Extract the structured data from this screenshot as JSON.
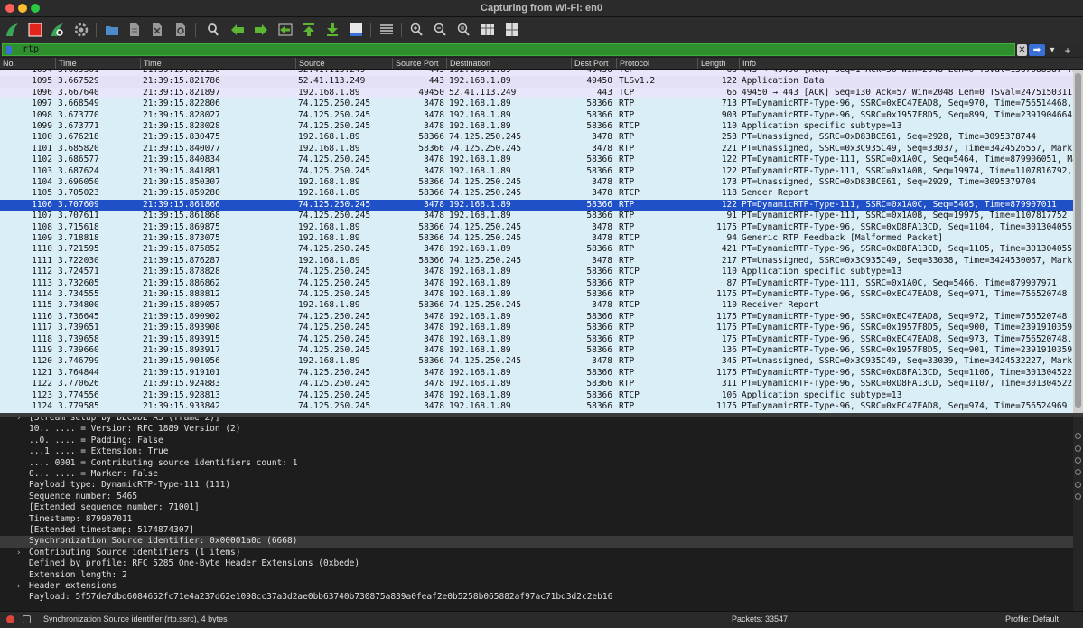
{
  "window": {
    "title": "Capturing from Wi-Fi: en0"
  },
  "colors": {
    "filter_bg": "#2f8f2f",
    "selected_row": "#1f50c8",
    "rtp_row": "#daeef8",
    "tls_row": "#e4e0f6",
    "tcp_row": "#e7e6fa"
  },
  "toolbar": {
    "buttons": [
      {
        "name": "start-capture-icon",
        "symbol": "shark-fin"
      },
      {
        "name": "stop-capture-icon",
        "symbol": "stop-square"
      },
      {
        "name": "restart-capture-icon",
        "symbol": "shark-fin-restart"
      },
      {
        "name": "capture-options-icon",
        "symbol": "gear"
      },
      {
        "name": "open-file-icon",
        "symbol": "folder"
      },
      {
        "name": "save-file-icon",
        "symbol": "file"
      },
      {
        "name": "close-file-icon",
        "symbol": "file-x"
      },
      {
        "name": "reload-file-icon",
        "symbol": "file-reload"
      },
      {
        "name": "find-packet-icon",
        "symbol": "magnifier"
      },
      {
        "name": "go-back-icon",
        "symbol": "arrow-left"
      },
      {
        "name": "go-forward-icon",
        "symbol": "arrow-right"
      },
      {
        "name": "go-to-packet-icon",
        "symbol": "arrow-into"
      },
      {
        "name": "go-first-icon",
        "symbol": "arrow-top"
      },
      {
        "name": "go-last-icon",
        "symbol": "arrow-bottom"
      },
      {
        "name": "auto-scroll-icon",
        "symbol": "autoscroll"
      },
      {
        "name": "colorize-icon",
        "symbol": "lines"
      },
      {
        "name": "zoom-in-icon",
        "symbol": "zoom-in"
      },
      {
        "name": "zoom-out-icon",
        "symbol": "zoom-out"
      },
      {
        "name": "normal-size-icon",
        "symbol": "zoom-normal"
      },
      {
        "name": "resize-columns-icon",
        "symbol": "resize"
      },
      {
        "name": "layout-icon",
        "symbol": "layout"
      }
    ]
  },
  "filter": {
    "value": "rtp",
    "plus": "+",
    "dots": ".."
  },
  "columns": [
    "No.",
    "Time",
    "Time",
    "Source",
    "Source Port",
    "Destination",
    "Dest Port",
    "Protocol",
    "Length",
    "Info"
  ],
  "packets": [
    {
      "no": "1094",
      "t": "3.665301",
      "abs": "21:39:15.821130",
      "src": "52.41.113.249",
      "sp": "443",
      "dst": "192.168.1.89",
      "dp": "49450",
      "proto": "TCP",
      "len": "66",
      "info": "443 → 49450 [ACK] Seq=1 Ack=56 Win=2048 Len=0 TSval=1567088387 TSecr",
      "kind": "tcp"
    },
    {
      "no": "1095",
      "t": "3.667529",
      "abs": "21:39:15.821786",
      "src": "52.41.113.249",
      "sp": "443",
      "dst": "192.168.1.89",
      "dp": "49450",
      "proto": "TLSv1.2",
      "len": "122",
      "info": "Application Data",
      "kind": "tls"
    },
    {
      "no": "1096",
      "t": "3.667640",
      "abs": "21:39:15.821897",
      "src": "192.168.1.89",
      "sp": "49450",
      "dst": "52.41.113.249",
      "dp": "443",
      "proto": "TCP",
      "len": "66",
      "info": "49450 → 443 [ACK] Seq=130 Ack=57 Win=2048 Len=0 TSval=2475150311 TSe",
      "kind": "tcp"
    },
    {
      "no": "1097",
      "t": "3.668549",
      "abs": "21:39:15.822806",
      "src": "74.125.250.245",
      "sp": "3478",
      "dst": "192.168.1.89",
      "dp": "58366",
      "proto": "RTP",
      "len": "713",
      "info": "PT=DynamicRTP-Type-96, SSRC=0xEC47EAD8, Seq=970, Time=756514468, Mark",
      "kind": "rtp"
    },
    {
      "no": "1098",
      "t": "3.673770",
      "abs": "21:39:15.828027",
      "src": "74.125.250.245",
      "sp": "3478",
      "dst": "192.168.1.89",
      "dp": "58366",
      "proto": "RTP",
      "len": "903",
      "info": "PT=DynamicRTP-Type-96, SSRC=0x1957F8D5, Seq=899, Time=2391904664, Ma",
      "kind": "rtp"
    },
    {
      "no": "1099",
      "t": "3.673771",
      "abs": "21:39:15.828028",
      "src": "74.125.250.245",
      "sp": "3478",
      "dst": "192.168.1.89",
      "dp": "58366",
      "proto": "RTCP",
      "len": "110",
      "info": "Application specific   subtype=13",
      "kind": "rtp"
    },
    {
      "no": "1100",
      "t": "3.676218",
      "abs": "21:39:15.830475",
      "src": "192.168.1.89",
      "sp": "58366",
      "dst": "74.125.250.245",
      "dp": "3478",
      "proto": "RTP",
      "len": "253",
      "info": "PT=Unassigned, SSRC=0xD83BCE61, Seq=2928, Time=3095378744",
      "kind": "rtp"
    },
    {
      "no": "1101",
      "t": "3.685820",
      "abs": "21:39:15.840077",
      "src": "192.168.1.89",
      "sp": "58366",
      "dst": "74.125.250.245",
      "dp": "3478",
      "proto": "RTP",
      "len": "221",
      "info": "PT=Unassigned, SSRC=0x3C935C49, Seq=33037, Time=3424526557, Mark",
      "kind": "rtp"
    },
    {
      "no": "1102",
      "t": "3.686577",
      "abs": "21:39:15.840834",
      "src": "74.125.250.245",
      "sp": "3478",
      "dst": "192.168.1.89",
      "dp": "58366",
      "proto": "RTP",
      "len": "122",
      "info": "PT=DynamicRTP-Type-111, SSRC=0x1A0C, Seq=5464, Time=879906051, Mark",
      "kind": "rtp"
    },
    {
      "no": "1103",
      "t": "3.687624",
      "abs": "21:39:15.841881",
      "src": "74.125.250.245",
      "sp": "3478",
      "dst": "192.168.1.89",
      "dp": "58366",
      "proto": "RTP",
      "len": "122",
      "info": "PT=DynamicRTP-Type-111, SSRC=0x1A0B, Seq=19974, Time=1107816792, Ma",
      "kind": "rtp"
    },
    {
      "no": "1104",
      "t": "3.696050",
      "abs": "21:39:15.850307",
      "src": "192.168.1.89",
      "sp": "58366",
      "dst": "74.125.250.245",
      "dp": "3478",
      "proto": "RTP",
      "len": "173",
      "info": "PT=Unassigned, SSRC=0xD83BCE61, Seq=2929, Time=3095379704",
      "kind": "rtp"
    },
    {
      "no": "1105",
      "t": "3.705023",
      "abs": "21:39:15.859280",
      "src": "192.168.1.89",
      "sp": "58366",
      "dst": "74.125.250.245",
      "dp": "3478",
      "proto": "RTCP",
      "len": "118",
      "info": "Sender Report",
      "kind": "rtp"
    },
    {
      "no": "1106",
      "t": "3.707609",
      "abs": "21:39:15.861866",
      "src": "74.125.250.245",
      "sp": "3478",
      "dst": "192.168.1.89",
      "dp": "58366",
      "proto": "RTP",
      "len": "122",
      "info": "PT=DynamicRTP-Type-111, SSRC=0x1A0C, Seq=5465, Time=879907011",
      "kind": "sel"
    },
    {
      "no": "1107",
      "t": "3.707611",
      "abs": "21:39:15.861868",
      "src": "74.125.250.245",
      "sp": "3478",
      "dst": "192.168.1.89",
      "dp": "58366",
      "proto": "RTP",
      "len": "91",
      "info": "PT=DynamicRTP-Type-111, SSRC=0x1A0B, Seq=19975, Time=1107817752",
      "kind": "rtp"
    },
    {
      "no": "1108",
      "t": "3.715618",
      "abs": "21:39:15.869875",
      "src": "192.168.1.89",
      "sp": "58366",
      "dst": "74.125.250.245",
      "dp": "3478",
      "proto": "RTP",
      "len": "1175",
      "info": "PT=DynamicRTP-Type-96, SSRC=0xD8FA13CD, Seq=1104, Time=3013040551",
      "kind": "rtp"
    },
    {
      "no": "1109",
      "t": "3.718818",
      "abs": "21:39:15.873075",
      "src": "192.168.1.89",
      "sp": "58366",
      "dst": "74.125.250.245",
      "dp": "3478",
      "proto": "RTCP",
      "len": "94",
      "info": "Generic RTP Feedback   [Malformed Packet]",
      "kind": "rtp"
    },
    {
      "no": "1110",
      "t": "3.721595",
      "abs": "21:39:15.875852",
      "src": "74.125.250.245",
      "sp": "3478",
      "dst": "192.168.1.89",
      "dp": "58366",
      "proto": "RTP",
      "len": "421",
      "info": "PT=DynamicRTP-Type-96, SSRC=0xD8FA13CD, Seq=1105, Time=3013040551, M",
      "kind": "rtp"
    },
    {
      "no": "1111",
      "t": "3.722030",
      "abs": "21:39:15.876287",
      "src": "192.168.1.89",
      "sp": "58366",
      "dst": "74.125.250.245",
      "dp": "3478",
      "proto": "RTP",
      "len": "217",
      "info": "PT=Unassigned, SSRC=0x3C935C49, Seq=33038, Time=3424530067, Mark",
      "kind": "rtp"
    },
    {
      "no": "1112",
      "t": "3.724571",
      "abs": "21:39:15.878828",
      "src": "74.125.250.245",
      "sp": "3478",
      "dst": "192.168.1.89",
      "dp": "58366",
      "proto": "RTCP",
      "len": "110",
      "info": "Application specific   subtype=13",
      "kind": "rtp"
    },
    {
      "no": "1113",
      "t": "3.732605",
      "abs": "21:39:15.886862",
      "src": "74.125.250.245",
      "sp": "3478",
      "dst": "192.168.1.89",
      "dp": "58366",
      "proto": "RTP",
      "len": "87",
      "info": "PT=DynamicRTP-Type-111, SSRC=0x1A0C, Seq=5466, Time=879907971",
      "kind": "rtp"
    },
    {
      "no": "1114",
      "t": "3.734555",
      "abs": "21:39:15.888812",
      "src": "74.125.250.245",
      "sp": "3478",
      "dst": "192.168.1.89",
      "dp": "58366",
      "proto": "RTP",
      "len": "1175",
      "info": "PT=DynamicRTP-Type-96, SSRC=0xEC47EAD8, Seq=971, Time=756520748",
      "kind": "rtp"
    },
    {
      "no": "1115",
      "t": "3.734800",
      "abs": "21:39:15.889057",
      "src": "192.168.1.89",
      "sp": "58366",
      "dst": "74.125.250.245",
      "dp": "3478",
      "proto": "RTCP",
      "len": "110",
      "info": "Receiver Report",
      "kind": "rtp"
    },
    {
      "no": "1116",
      "t": "3.736645",
      "abs": "21:39:15.890902",
      "src": "74.125.250.245",
      "sp": "3478",
      "dst": "192.168.1.89",
      "dp": "58366",
      "proto": "RTP",
      "len": "1175",
      "info": "PT=DynamicRTP-Type-96, SSRC=0xEC47EAD8, Seq=972, Time=756520748",
      "kind": "rtp"
    },
    {
      "no": "1117",
      "t": "3.739651",
      "abs": "21:39:15.893908",
      "src": "74.125.250.245",
      "sp": "3478",
      "dst": "192.168.1.89",
      "dp": "58366",
      "proto": "RTP",
      "len": "1175",
      "info": "PT=DynamicRTP-Type-96, SSRC=0x1957F8D5, Seq=900, Time=2391910359",
      "kind": "rtp"
    },
    {
      "no": "1118",
      "t": "3.739658",
      "abs": "21:39:15.893915",
      "src": "74.125.250.245",
      "sp": "3478",
      "dst": "192.168.1.89",
      "dp": "58366",
      "proto": "RTP",
      "len": "175",
      "info": "PT=DynamicRTP-Type-96, SSRC=0xEC47EAD8, Seq=973, Time=756520748, Ma",
      "kind": "rtp"
    },
    {
      "no": "1119",
      "t": "3.739660",
      "abs": "21:39:15.893917",
      "src": "74.125.250.245",
      "sp": "3478",
      "dst": "192.168.1.89",
      "dp": "58366",
      "proto": "RTP",
      "len": "136",
      "info": "PT=DynamicRTP-Type-96, SSRC=0x1957F8D5, Seq=901, Time=2391910359, Ma",
      "kind": "rtp"
    },
    {
      "no": "1120",
      "t": "3.746799",
      "abs": "21:39:15.901056",
      "src": "192.168.1.89",
      "sp": "58366",
      "dst": "74.125.250.245",
      "dp": "3478",
      "proto": "RTP",
      "len": "345",
      "info": "PT=Unassigned, SSRC=0x3C935C49, Seq=33039, Time=3424532227, Mark",
      "kind": "rtp"
    },
    {
      "no": "1121",
      "t": "3.764844",
      "abs": "21:39:15.919101",
      "src": "74.125.250.245",
      "sp": "3478",
      "dst": "192.168.1.89",
      "dp": "58366",
      "proto": "RTP",
      "len": "1175",
      "info": "PT=DynamicRTP-Type-96, SSRC=0xD8FA13CD, Seq=1106, Time=3013045221",
      "kind": "rtp"
    },
    {
      "no": "1122",
      "t": "3.770626",
      "abs": "21:39:15.924883",
      "src": "74.125.250.245",
      "sp": "3478",
      "dst": "192.168.1.89",
      "dp": "58366",
      "proto": "RTP",
      "len": "311",
      "info": "PT=DynamicRTP-Type-96, SSRC=0xD8FA13CD, Seq=1107, Time=3013045221, M",
      "kind": "rtp"
    },
    {
      "no": "1123",
      "t": "3.774556",
      "abs": "21:39:15.928813",
      "src": "74.125.250.245",
      "sp": "3478",
      "dst": "192.168.1.89",
      "dp": "58366",
      "proto": "RTCP",
      "len": "106",
      "info": "Application specific   subtype=13",
      "kind": "rtp"
    },
    {
      "no": "1124",
      "t": "3.779585",
      "abs": "21:39:15.933842",
      "src": "74.125.250.245",
      "sp": "3478",
      "dst": "192.168.1.89",
      "dp": "58366",
      "proto": "RTP",
      "len": "1175",
      "info": "PT=DynamicRTP-Type-96, SSRC=0xEC47EAD8, Seq=974, Time=756524969",
      "kind": "rtp"
    }
  ],
  "details": [
    {
      "text": "[Stream setup by DECODE AS (frame 2)]",
      "indent": 1,
      "arrow": true,
      "hl": false
    },
    {
      "text": "10.. .... = Version: RFC 1889 Version (2)",
      "indent": 1,
      "arrow": false,
      "hl": false
    },
    {
      "text": "..0. .... = Padding: False",
      "indent": 1,
      "arrow": false,
      "hl": false
    },
    {
      "text": "...1 .... = Extension: True",
      "indent": 1,
      "arrow": false,
      "hl": false
    },
    {
      "text": ".... 0001 = Contributing source identifiers count: 1",
      "indent": 1,
      "arrow": false,
      "hl": false
    },
    {
      "text": "0... .... = Marker: False",
      "indent": 1,
      "arrow": false,
      "hl": false
    },
    {
      "text": "Payload type: DynamicRTP-Type-111 (111)",
      "indent": 1,
      "arrow": false,
      "hl": false
    },
    {
      "text": "Sequence number: 5465",
      "indent": 1,
      "arrow": false,
      "hl": false
    },
    {
      "text": "[Extended sequence number: 71001]",
      "indent": 1,
      "arrow": false,
      "hl": false
    },
    {
      "text": "Timestamp: 879907011",
      "indent": 1,
      "arrow": false,
      "hl": false
    },
    {
      "text": "[Extended timestamp: 5174874307]",
      "indent": 1,
      "arrow": false,
      "hl": false
    },
    {
      "text": "Synchronization Source identifier: 0x00001a0c (6668)",
      "indent": 1,
      "arrow": false,
      "hl": true
    },
    {
      "text": "Contributing Source identifiers (1 items)",
      "indent": 1,
      "arrow": true,
      "hl": false
    },
    {
      "text": "Defined by profile: RFC 5285 One-Byte Header Extensions (0xbede)",
      "indent": 1,
      "arrow": false,
      "hl": false
    },
    {
      "text": "Extension length: 2",
      "indent": 1,
      "arrow": false,
      "hl": false
    },
    {
      "text": "Header extensions",
      "indent": 1,
      "arrow": true,
      "hl": false
    },
    {
      "text": "Payload: 5f57de7dbd6084652fc71e4a237d62e1098cc37a3d2ae0bb63740b730875a839a0feaf2e0b5258b065882af97ac71bd3d2c2eb16",
      "indent": 1,
      "arrow": false,
      "hl": false
    }
  ],
  "status": {
    "field": "Synchronization Source identifier (rtp.ssrc), 4 bytes",
    "packets": "Packets: 33547",
    "profile": "Profile: Default"
  }
}
